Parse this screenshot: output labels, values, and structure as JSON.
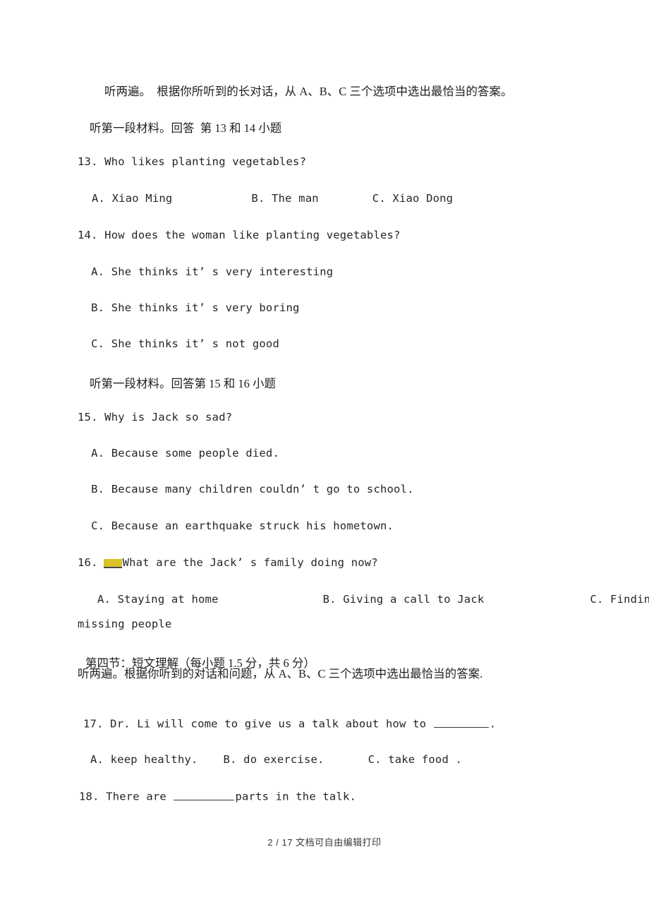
{
  "document": {
    "page_label": "2 / 17",
    "footer_note": "文档可自由编辑打印",
    "highlight_color": "#d8c32a",
    "text_color": "#252525"
  },
  "instructions": {
    "listen_twice_long_dialog": "听两遍。  根据你所听到的长对话，从 A、B、C 三个选项中选出最恰当的答案。",
    "material_13_14": "听第一段材料。回答  第 13 和 14 小题",
    "material_15_16": "听第一段材料。回答第 15 和 16 小题",
    "section_four_title": "第四节：短文理解（每小题 1.5 分，共 6 分）",
    "listen_twice_passage": "听两遍。根据你听到的对话和问题，从 A、B、C 三个选项中选出最恰当的答案."
  },
  "questions": [
    {
      "number": "13.",
      "stem": "Who likes planting vegetables?",
      "layout": "inline",
      "options": [
        {
          "label": "A.",
          "text": "Xiao Ming"
        },
        {
          "label": "B.",
          "text": "The man"
        },
        {
          "label": "C.",
          "text": "Xiao Dong"
        }
      ]
    },
    {
      "number": "14.",
      "stem": "How does the woman like planting vegetables?",
      "layout": "stacked",
      "options": [
        {
          "label": "A.",
          "text": "She thinks it’ s very interesting"
        },
        {
          "label": "B.",
          "text": "She thinks it’ s very boring"
        },
        {
          "label": "C.",
          "text": "She thinks it’ s not good"
        }
      ]
    },
    {
      "number": "15.",
      "stem": "Why is Jack so sad?",
      "layout": "stacked",
      "options": [
        {
          "label": "A.",
          "text": "Because some people died."
        },
        {
          "label": "B.",
          "text": "Because many children couldn’ t go to school."
        },
        {
          "label": "C.",
          "text": "Because an earthquake struck his hometown."
        }
      ]
    },
    {
      "number": "16.",
      "stem": "What are the Jack’ s family doing now?",
      "has_highlight_blank": true,
      "layout": "inline-wrap",
      "options": [
        {
          "label": "A.",
          "text": "Staying at home"
        },
        {
          "label": "B.",
          "text": "Giving a call to Jack"
        },
        {
          "label": "C.",
          "text": "Finding the"
        }
      ],
      "wrapped_text": "missing people"
    },
    {
      "number": "17.",
      "stem_before_blank": "Dr. Li will come to give us a talk about how to ",
      "stem_after_blank": ".",
      "layout": "inline",
      "options": [
        {
          "label": "A.",
          "text": "keep healthy."
        },
        {
          "label": "B.",
          "text": "do exercise."
        },
        {
          "label": "C.",
          "text": "take food ."
        }
      ]
    },
    {
      "number": "18.",
      "stem_before_blank": "There are ",
      "stem_after_blank": "parts in the talk.",
      "layout": "blank-only",
      "options": []
    }
  ]
}
